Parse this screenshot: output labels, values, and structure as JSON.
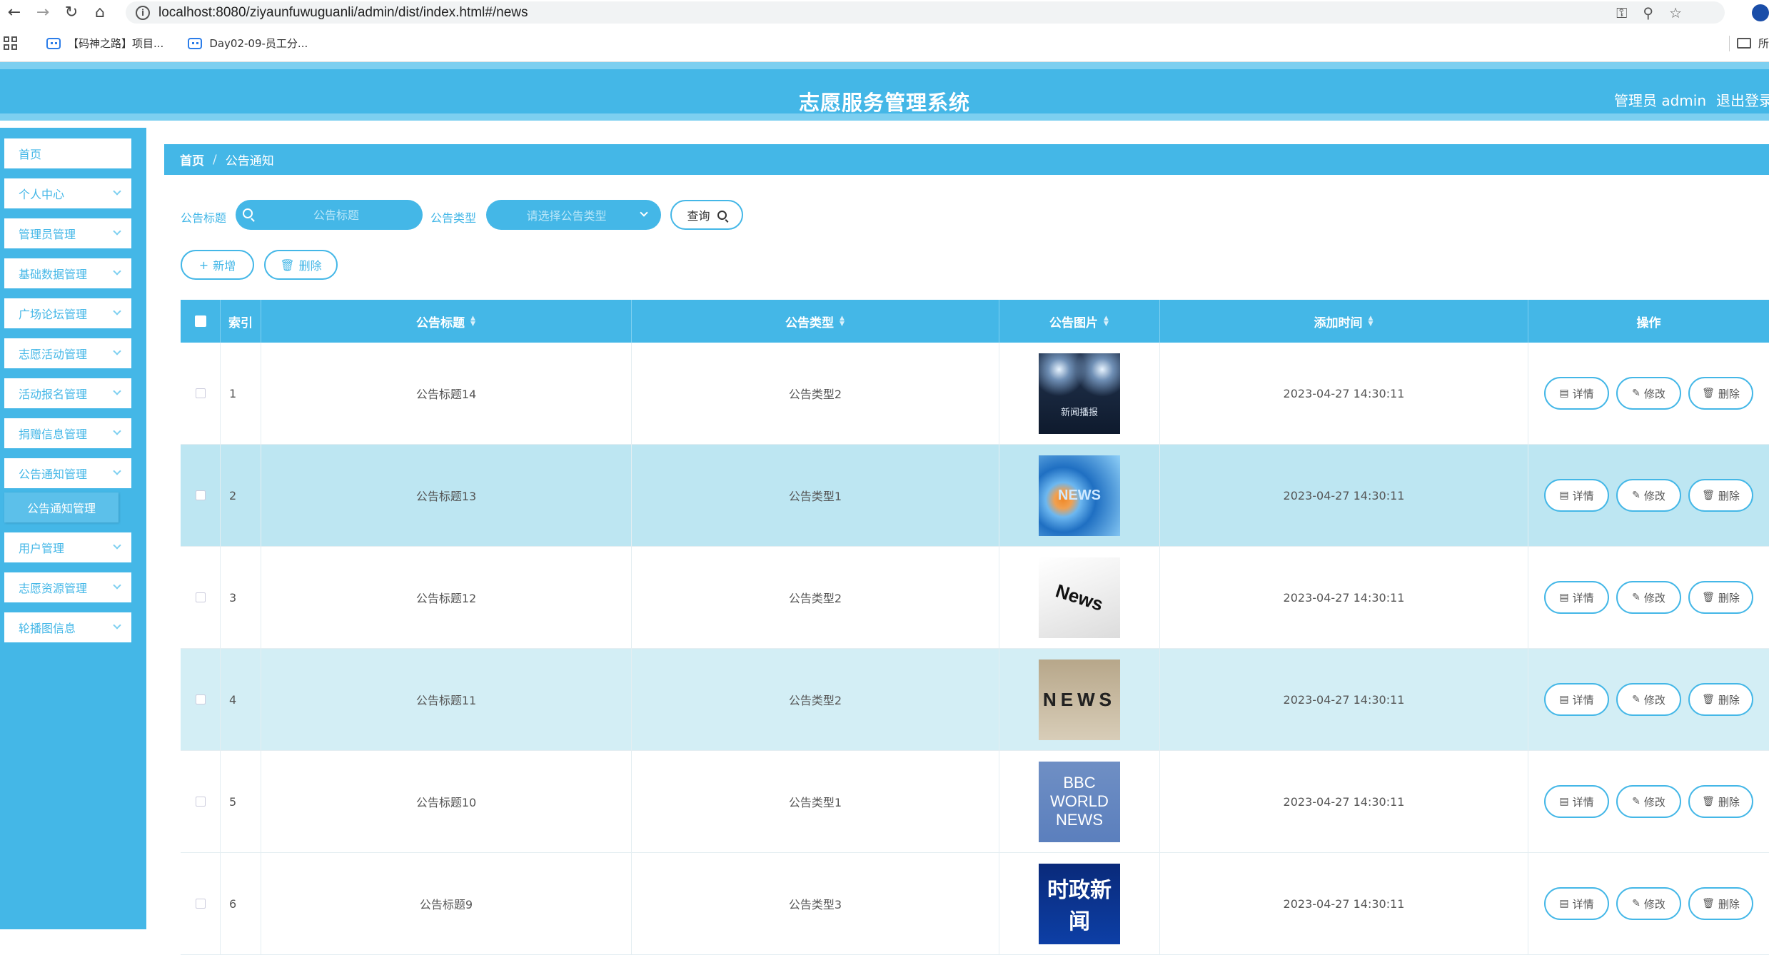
{
  "browser": {
    "url": "localhost:8080/ziyaunfuwuguanli/admin/dist/index.html#/news",
    "bookmarks": [
      "【码神之路】项目...",
      "Day02-09-员工分..."
    ],
    "bookmarks_right": "所"
  },
  "header": {
    "title": "志愿服务管理系统",
    "user": "管理员 admin",
    "logout": "退出登录"
  },
  "sidebar": {
    "items": [
      {
        "label": "首页",
        "expandable": false
      },
      {
        "label": "个人中心",
        "expandable": true
      },
      {
        "label": "管理员管理",
        "expandable": true
      },
      {
        "label": "基础数据管理",
        "expandable": true
      },
      {
        "label": "广场论坛管理",
        "expandable": true
      },
      {
        "label": "志愿活动管理",
        "expandable": true
      },
      {
        "label": "活动报名管理",
        "expandable": true
      },
      {
        "label": "捐赠信息管理",
        "expandable": true
      },
      {
        "label": "公告通知管理",
        "expandable": true
      },
      {
        "label": "用户管理",
        "expandable": true
      },
      {
        "label": "志愿资源管理",
        "expandable": true
      },
      {
        "label": "轮播图信息",
        "expandable": true
      }
    ],
    "active_sub": "公告通知管理"
  },
  "breadcrumb": {
    "home": "首页",
    "current": "公告通知"
  },
  "search": {
    "title_label": "公告标题",
    "title_placeholder": "公告标题",
    "type_label": "公告类型",
    "type_placeholder": "请选择公告类型",
    "query": "查询"
  },
  "actions": {
    "add": "新增",
    "delete": "删除"
  },
  "table": {
    "headers": {
      "index": "索引",
      "title": "公告标题",
      "type": "公告类型",
      "image": "公告图片",
      "time": "添加时间",
      "ops": "操作"
    },
    "ops": {
      "detail": "详情",
      "edit": "修改",
      "delete": "删除"
    },
    "rows": [
      {
        "index": "1",
        "title": "公告标题14",
        "type": "公告类型2",
        "image_text": "新闻播报",
        "time": "2023-04-27 14:30:11"
      },
      {
        "index": "2",
        "title": "公告标题13",
        "type": "公告类型1",
        "image_text": "NEWS",
        "time": "2023-04-27 14:30:11"
      },
      {
        "index": "3",
        "title": "公告标题12",
        "type": "公告类型2",
        "image_text": "News",
        "time": "2023-04-27 14:30:11"
      },
      {
        "index": "4",
        "title": "公告标题11",
        "type": "公告类型2",
        "image_text": "NEWS",
        "time": "2023-04-27 14:30:11"
      },
      {
        "index": "5",
        "title": "公告标题10",
        "type": "公告类型1",
        "image_text": "BBC WORLD NEWS",
        "time": "2023-04-27 14:30:11"
      },
      {
        "index": "6",
        "title": "公告标题9",
        "type": "公告类型3",
        "image_text": "时政新闻",
        "time": "2023-04-27 14:30:11"
      }
    ]
  }
}
